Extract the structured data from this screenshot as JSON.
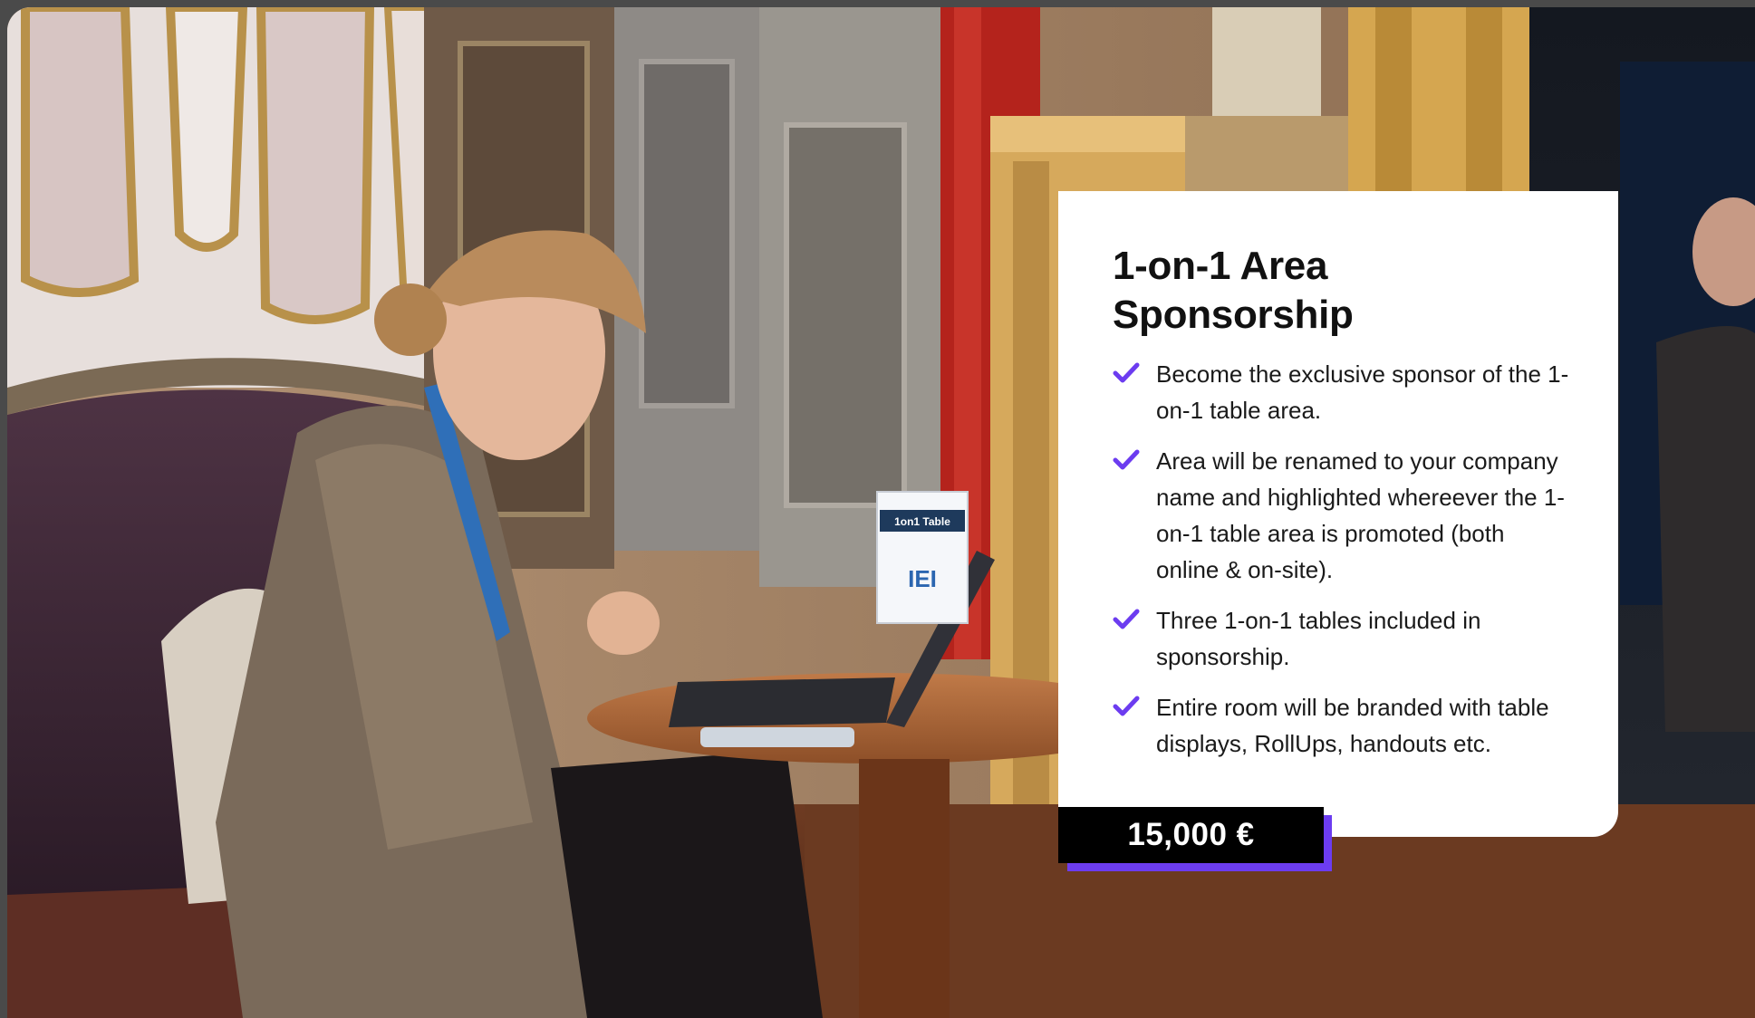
{
  "card": {
    "title_line1": "1-on-1 Area",
    "title_line2": "Sponsorship",
    "benefits": [
      "Become the exclusive sponsor of the 1-on-1 table area.",
      "Area will be renamed to your company name and highlighted whereever the 1-on-1 table area is promoted (both online & on-site).",
      "Three 1-on-1 tables included in sponsorship.",
      "Entire room will be branded with table displays, RollUps, handouts etc."
    ],
    "price": "15,000 €"
  },
  "photo": {
    "sign_label": "1on1 Table",
    "sign_logo": "IEI"
  },
  "colors": {
    "accent": "#6c3cf0",
    "card_bg": "#ffffff",
    "price_bg": "#000000"
  },
  "icons": {
    "benefit_bullet": "checkmark-icon"
  }
}
